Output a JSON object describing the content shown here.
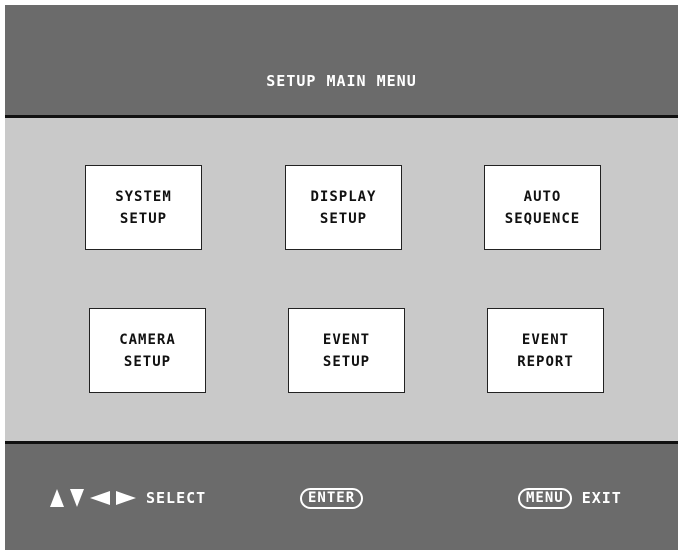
{
  "header": {
    "title": "SETUP MAIN MENU"
  },
  "menu": {
    "system_setup": "SYSTEM\nSETUP",
    "display_setup": "DISPLAY\nSETUP",
    "auto_sequence": "AUTO\nSEQUENCE",
    "camera_setup": "CAMERA\nSETUP",
    "event_setup": "EVENT\nSETUP",
    "event_report": "EVENT\nREPORT"
  },
  "footer": {
    "select_label": "SELECT",
    "enter_label": "ENTER",
    "menu_label": "MENU",
    "exit_label": "EXIT"
  }
}
